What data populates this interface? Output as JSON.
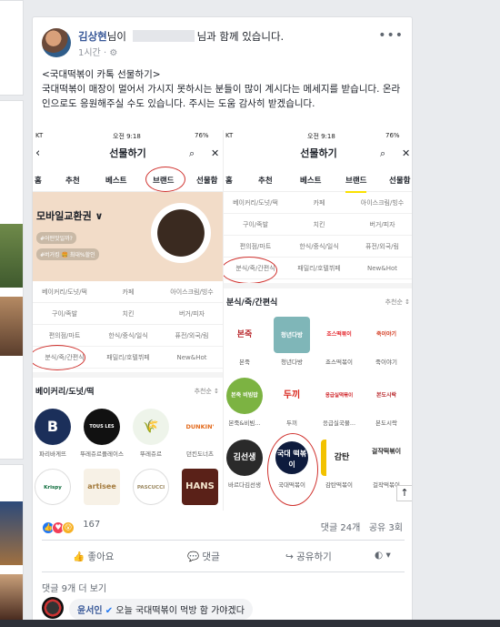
{
  "post": {
    "author": "김상현",
    "with_text_prefix": "님이 ",
    "with_text_suffix": "님과 함께 있습니다.",
    "time": "1시간 · ",
    "body": "<국대떡볶이 카톡 선물하기>\n국대떡볶이 매장이 멀어서 가시지 못하시는 분들이 많이 계시다는 메세지를 받습니다. 온라인으로도 응원해주실 수도 있습니다. 주시는 도움 감사히 받겠습니다.",
    "more": "•••"
  },
  "screenshot_left": {
    "status": {
      "carrier": "KT",
      "time": "오전 9:18",
      "battery": "76%"
    },
    "title": "선물하기",
    "tabs": [
      "홈",
      "추천",
      "베스트",
      "브랜드",
      "선물함"
    ],
    "banner_title": "모바일교환권 ∨",
    "banner_tags": [
      "#어떤맛일까?",
      "#버거킹 🍔 최대%할인"
    ],
    "categories": [
      "베이커리/도넛/떡",
      "카페",
      "아이스크림/빙수",
      "구이/족발",
      "치킨",
      "버거/피자",
      "편의점/마트",
      "한식/중식/일식",
      "퓨전/외국/림",
      "분식/죽/간편식",
      "패밀리/호텔뷔페",
      "New&Hot"
    ],
    "section_title": "베이커리/도넛/떡",
    "section_sort": "추천순 ↕",
    "brands": [
      "파리바게뜨",
      "뚜레쥬르플레이스",
      "뚜레쥬르",
      "던킨도너츠"
    ],
    "brand_logos": [
      "B",
      "TOUS LES JOURS",
      "🌾",
      "DUNKIN'"
    ],
    "brands_row2_logos": [
      "Krispy Kreme",
      "artisee",
      "PASCUCCI",
      "HANS"
    ]
  },
  "screenshot_right": {
    "status": {
      "carrier": "KT",
      "time": "오전 9:18",
      "battery": "76%"
    },
    "title": "선물하기",
    "tabs": [
      "홈",
      "추천",
      "베스트",
      "브랜드",
      "선물함"
    ],
    "categories": [
      "베이커리/도넛/떡",
      "카페",
      "아이스크림/빙수",
      "구이/족발",
      "치킨",
      "버거/피자",
      "편의점/마트",
      "한식/중식/일식",
      "퓨전/외국/림",
      "분식/죽/간편식",
      "패밀리/호텔뷔페",
      "New&Hot"
    ],
    "section_title": "분식/죽/간편식",
    "section_sort": "추천순 ↕",
    "brands": [
      "본죽",
      "청년다방",
      "죠스떡볶이",
      "죽이야기",
      "본죽&비빔...",
      "두끼",
      "응급실국물...",
      "본도시락",
      "바르다김선생",
      "국대떡볶이",
      "감탄떡볶이",
      "걸작떡볶이"
    ],
    "brand_logos": [
      "본죽",
      "청년다방",
      "죠스떡볶이",
      "죽이야기",
      "본죽 비빔밥",
      "두끼",
      "응급실떡볶이",
      "본도시락",
      "김선생",
      "국대 떡볶이",
      "감탄",
      "걸작떡볶이"
    ]
  },
  "reactions": {
    "count": "167",
    "comments": "댓글 24개",
    "shares": "공유 3회"
  },
  "actions": {
    "like": "좋아요",
    "comment": "댓글",
    "share": "공유하기"
  },
  "comments": {
    "more": "댓글 9개 더 보기",
    "items": [
      {
        "author": "윤서인",
        "text": "오늘 국대떡볶이 먹방 함 가야겠다"
      }
    ]
  },
  "colors": {
    "fb_blue": "#385898",
    "accent_yellow": "#fae100",
    "circle_red": "#d0312d"
  }
}
